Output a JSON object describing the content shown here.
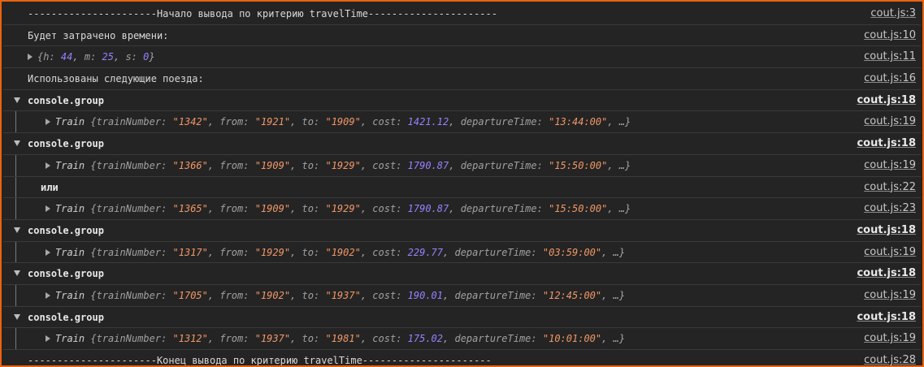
{
  "log": {
    "start_line": "----------------------Начало вывода по критерию travelTime----------------------",
    "time_label": "Будет затрачено времени:",
    "time_obj": {
      "h": "44",
      "m": "25",
      "s": "0"
    },
    "trains_label": "Использованы следующие поезда:",
    "group_label": "console.group",
    "or_label": "или",
    "end_line": "----------------------Конец вывода по критерию travelTime----------------------"
  },
  "sources": {
    "s3": "cout.js:3",
    "s10": "cout.js:10",
    "s11": "cout.js:11",
    "s16": "cout.js:16",
    "s18": "cout.js:18",
    "s19": "cout.js:19",
    "s22": "cout.js:22",
    "s23": "cout.js:23",
    "s28": "cout.js:28"
  },
  "trains": [
    {
      "trainNumber": "\"1342\"",
      "from": "\"1921\"",
      "to": "\"1909\"",
      "cost": "1421.12",
      "departureTime": "\"13:44:00\""
    },
    {
      "trainNumber": "\"1366\"",
      "from": "\"1909\"",
      "to": "\"1929\"",
      "cost": "1790.87",
      "departureTime": "\"15:50:00\""
    },
    {
      "trainNumber": "\"1365\"",
      "from": "\"1909\"",
      "to": "\"1929\"",
      "cost": "1790.87",
      "departureTime": "\"15:50:00\""
    },
    {
      "trainNumber": "\"1317\"",
      "from": "\"1929\"",
      "to": "\"1902\"",
      "cost": "229.77",
      "departureTime": "\"03:59:00\""
    },
    {
      "trainNumber": "\"1705\"",
      "from": "\"1902\"",
      "to": "\"1937\"",
      "cost": "190.01",
      "departureTime": "\"12:45:00\""
    },
    {
      "trainNumber": "\"1312\"",
      "from": "\"1937\"",
      "to": "\"1981\"",
      "cost": "175.02",
      "departureTime": "\"10:01:00\""
    }
  ],
  "obj_tokens": {
    "class_name": "Train",
    "open": "{",
    "k_trainNumber": "trainNumber:",
    "k_from": "from:",
    "k_to": "to:",
    "k_cost": "cost:",
    "k_departureTime": "departureTime:",
    "ellipsis": "…}",
    "comma": ",",
    "k_h": "h:",
    "k_m": "m:",
    "k_s": "s:",
    "close": "}"
  },
  "colors": {
    "background": "#242424",
    "frame_border": "#e8630f",
    "string": "#f29766",
    "number": "#9980ff"
  }
}
